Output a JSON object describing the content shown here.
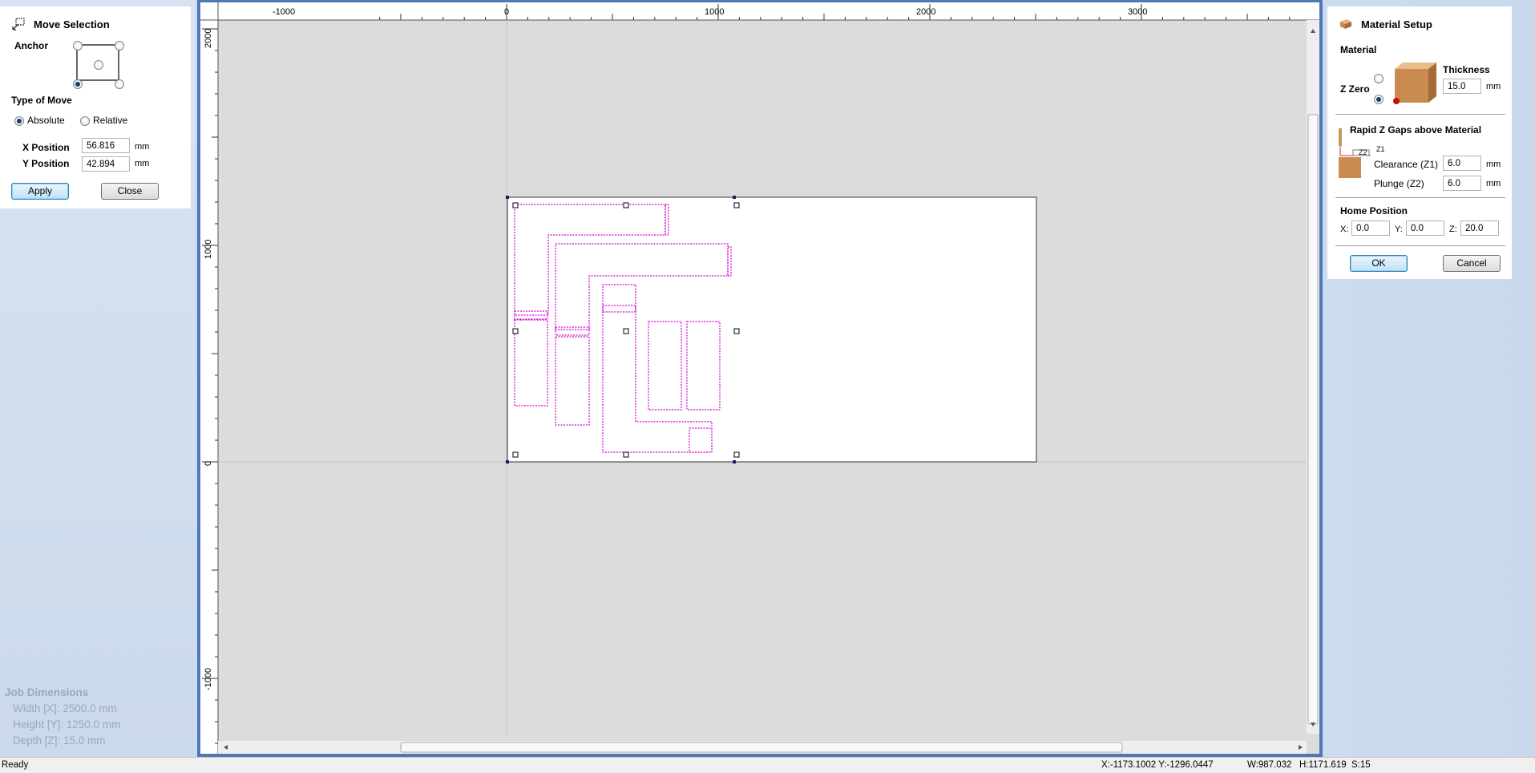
{
  "move_selection": {
    "title": "Move Selection",
    "anchor_label": "Anchor",
    "type_of_move_label": "Type of Move",
    "absolute_label": "Absolute",
    "relative_label": "Relative",
    "selected_move_type": "Absolute",
    "x_label": "X Position",
    "x_value": "56.816",
    "x_unit": "mm",
    "y_label": "Y Position",
    "y_value": "42.894",
    "y_unit": "mm",
    "apply_label": "Apply",
    "close_label": "Close"
  },
  "job_dimensions": {
    "title": "Job Dimensions",
    "width": "Width  [X]: 2500.0 mm",
    "height": "Height [Y]: 1250.0 mm",
    "depth": "Depth  [Z]: 15.0 mm"
  },
  "rulers": {
    "top": [
      "-1000",
      "0",
      "1000",
      "2000",
      "3000"
    ],
    "left": [
      "2000",
      "1000",
      "0",
      "-1000"
    ]
  },
  "material_setup": {
    "title": "Material Setup",
    "material_label": "Material",
    "z_zero_label": "Z Zero",
    "thickness_label": "Thickness",
    "thickness_value": "15.0",
    "thickness_unit": "mm",
    "rapid_label": "Rapid Z Gaps above Material",
    "z1_tag": "Z1",
    "z2_tag": "Z2",
    "clearance_label": "Clearance (Z1)",
    "clearance_value": "6.0",
    "clearance_unit": "mm",
    "plunge_label": "Plunge (Z2)",
    "plunge_value": "6.0",
    "plunge_unit": "mm",
    "home_label": "Home Position",
    "home_x_label": "X:",
    "home_x": "0.0",
    "home_y_label": "Y:",
    "home_y": "0.0",
    "home_z_label": "Z:",
    "home_z": "20.0",
    "ok_label": "OK",
    "cancel_label": "Cancel"
  },
  "status": {
    "state": "Ready",
    "cursor": "X:-1173.1002 Y:-1296.0447",
    "size": "W:987.032   H:1171.619  S:15"
  },
  "colors": {
    "frame": "#4d79b7",
    "vector": "#d400d4",
    "canvas_bg": "#dcdcdc"
  }
}
